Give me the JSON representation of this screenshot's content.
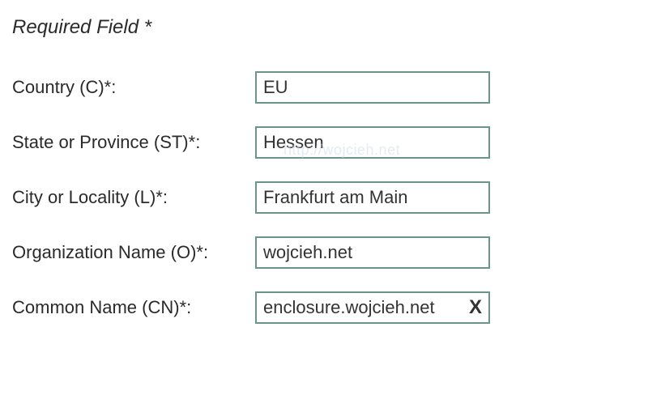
{
  "header": {
    "required_text": "Required Field *"
  },
  "watermark": "http://wojcieh.net",
  "form": {
    "country": {
      "label": "Country (C)*:",
      "value": "EU"
    },
    "state": {
      "label": "State or Province (ST)*:",
      "value": "Hessen"
    },
    "city": {
      "label": "City or Locality (L)*:",
      "value": "Frankfurt am Main"
    },
    "organization": {
      "label": "Organization Name (O)*:",
      "value": "wojcieh.net"
    },
    "common_name": {
      "label": "Common Name (CN)*:",
      "value": "enclosure.wojcieh.net"
    }
  },
  "icons": {
    "clear": "X"
  }
}
